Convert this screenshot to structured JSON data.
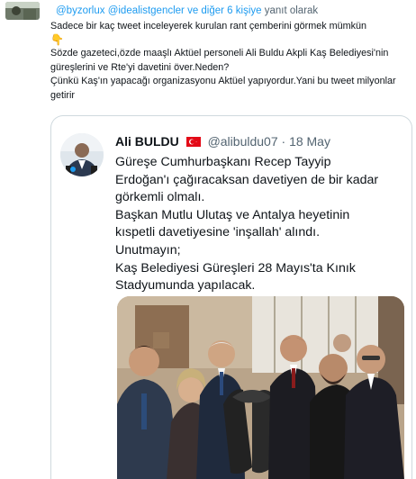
{
  "reply": {
    "prefix": "",
    "mentions": "@byzorlux @idealistgencler  ve diğer 6 kişiye",
    "suffix": " yanıt olarak"
  },
  "tweet": {
    "lines": [
      "Sadece bir kaç tweet inceleyerek kurulan rant çemberini görmek mümkün",
      "Sözde gazeteci,özde maaşlı Aktüel personeli Ali Buldu Akpli Kaş Belediyesi'nin güreşlerini ve Rte'yi davetini över.Neden?",
      "Çünkü Kaş'ın yapacağı organizasyonu Aktüel yapıyordur.Yani bu tweet milyonlar getirir"
    ],
    "emoji": "👇"
  },
  "quote": {
    "name": "Ali BULDU",
    "flag": "turkey-flag",
    "handle": "@alibuldu07",
    "separator": "·",
    "date": "18 May",
    "lines": [
      "Güreşe Cumhurbaşkanı Recep Tayyip",
      "Erdoğan'ı çağıracaksan davetiyen de bir kadar",
      "görkemli olmalı.",
      "Başkan Mutlu Ulutaş ve Antalya heyetinin",
      "kıspetli davetiyesine 'inşallah' alındı.",
      "Unutmayın;",
      "Kaş Belediyesi Güreşleri 28 Mayıs'ta Kınık",
      "Stadyumunda yapılacak."
    ]
  },
  "colors": {
    "link": "#1d9bf0",
    "secondary_text": "#536471",
    "border": "#cfd9de",
    "text": "#0f1419"
  }
}
